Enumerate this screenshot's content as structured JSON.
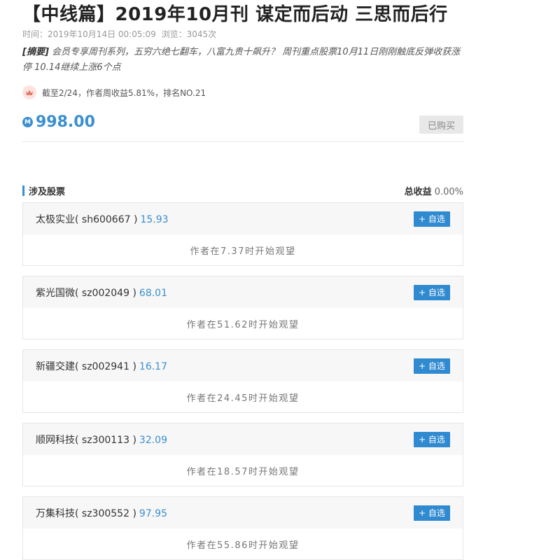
{
  "article": {
    "title": "【中线篇】2019年10月刊 谋定而后动 三思而后行",
    "time_label": "时间：2019年10月14日 00:05:09",
    "views_label": "浏览：3045次",
    "summary_tag": "[摘要]",
    "summary_text": "会员专享周刊系列，五穷六绝七翻车，八富九贵十飙升？ 周刊重点股票10月11日刚刚触底反弹收获涨停 10.14继续上涨6个点",
    "rank_text": "截至2/24，作者周收益5.81%，排名NO.21",
    "crown_icon": "crown-icon",
    "price": "998.00",
    "coin_symbol": "M",
    "bought_label": "已购买"
  },
  "section": {
    "title": "涉及股票",
    "total_label": "总收益",
    "total_value": "0.00%"
  },
  "colors": {
    "accent": "#3a8fd0",
    "button": "#2f8ad0",
    "crown": "#e8776a"
  },
  "stocks": [
    {
      "name": "太极实业( sh600667 )",
      "price": "15.93",
      "add_label": "+ 自选",
      "note": "作者在7.37时开始观望"
    },
    {
      "name": "紫光国微( sz002049 )",
      "price": "68.01",
      "add_label": "+ 自选",
      "note": "作者在51.62时开始观望"
    },
    {
      "name": "新疆交建( sz002941 )",
      "price": "16.17",
      "add_label": "+ 自选",
      "note": "作者在24.45时开始观望"
    },
    {
      "name": "顺网科技( sz300113 )",
      "price": "32.09",
      "add_label": "+ 自选",
      "note": "作者在18.57时开始观望"
    },
    {
      "name": "万集科技( sz300552 )",
      "price": "97.95",
      "add_label": "+ 自选",
      "note": "作者在55.86时开始观望"
    }
  ]
}
